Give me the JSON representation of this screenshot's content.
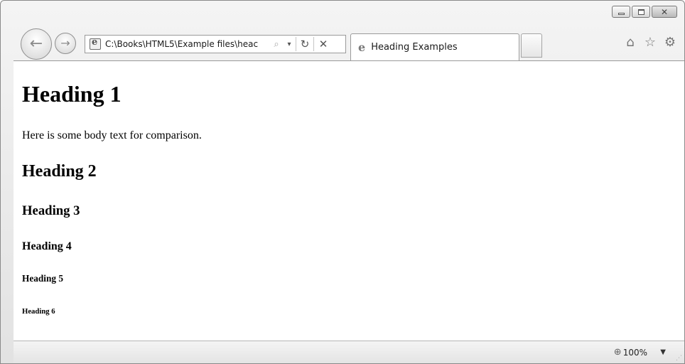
{
  "window": {
    "minimize_symbol": "",
    "close_symbol": "✕"
  },
  "nav": {
    "back_symbol": "←",
    "forward_symbol": "→"
  },
  "address": {
    "url": "C:\\Books\\HTML5\\Example files\\heac",
    "search_symbol": "⌕",
    "dropdown_symbol": "▾",
    "refresh_symbol": "↻",
    "stop_symbol": "✕"
  },
  "tab": {
    "icon_symbol": "e",
    "label": "Heading Examples"
  },
  "commands": {
    "home_symbol": "⌂",
    "favorites_symbol": "☆",
    "tools_symbol": "⚙"
  },
  "page": {
    "h1": "Heading 1",
    "body_text": "Here is some body text for comparison.",
    "h2": "Heading 2",
    "h3": "Heading 3",
    "h4": "Heading 4",
    "h5": "Heading 5",
    "h6": "Heading 6"
  },
  "status": {
    "zoom_symbol": "⊕",
    "zoom_level": "100%",
    "zoom_dropdown_symbol": "▼",
    "resize_grip": "⋰"
  }
}
